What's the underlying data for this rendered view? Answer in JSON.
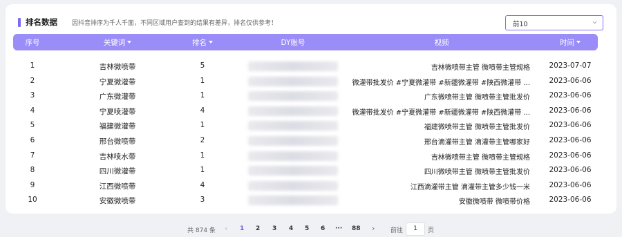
{
  "header": {
    "title": "排名数据",
    "subtitle": "因抖音排序为千人千面，不同区域用户查到的结果有差异，排名仅供参考！"
  },
  "filter": {
    "selected": "前10"
  },
  "table": {
    "columns": {
      "index": "序号",
      "keyword": "关键词",
      "rank": "排名",
      "account": "DY账号",
      "video": "视频",
      "time": "时间"
    },
    "rows": [
      {
        "index": "1",
        "keyword": "吉林微喷带",
        "rank": "5",
        "video": "吉林微喷带主管 微喷带主管规格",
        "time": "2023-07-07"
      },
      {
        "index": "2",
        "keyword": "宁夏微灌带",
        "rank": "1",
        "video": "微灌带批发价 #宁夏微灌带 #新疆微灌带 #陕西微灌带 ...",
        "time": "2023-06-06"
      },
      {
        "index": "3",
        "keyword": "广东微灌带",
        "rank": "1",
        "video": "广东微喷带主管 微喷带主管批发价",
        "time": "2023-06-06"
      },
      {
        "index": "4",
        "keyword": "宁夏喷灌带",
        "rank": "4",
        "video": "微灌带批发价 #宁夏微灌带 #新疆微灌带 #陕西微灌带 ...",
        "time": "2023-06-06"
      },
      {
        "index": "5",
        "keyword": "福建微灌带",
        "rank": "1",
        "video": "福建微喷带主管 微喷带主管批发价",
        "time": "2023-06-06"
      },
      {
        "index": "6",
        "keyword": "邢台微喷带",
        "rank": "2",
        "video": "邢台滴灌带主管 滴灌带主管哪家好",
        "time": "2023-06-06"
      },
      {
        "index": "7",
        "keyword": "吉林喷水带",
        "rank": "1",
        "video": "吉林微喷带主管 微喷带主管规格",
        "time": "2023-06-06"
      },
      {
        "index": "8",
        "keyword": "四川微灌带",
        "rank": "1",
        "video": "四川微喷带主管 微喷带主管批发价",
        "time": "2023-06-06"
      },
      {
        "index": "9",
        "keyword": "江西微喷带",
        "rank": "4",
        "video": "江西滴灌带主管 滴灌带主管多少钱一米",
        "time": "2023-06-06"
      },
      {
        "index": "10",
        "keyword": "安徽微喷带",
        "rank": "3",
        "video": "安徽微喷带 微喷带价格",
        "time": "2023-06-06"
      }
    ]
  },
  "pagination": {
    "total": "共 874 条",
    "prev": "‹",
    "pages": [
      "1",
      "2",
      "3",
      "4",
      "5",
      "6"
    ],
    "ellipsis": "···",
    "last": "88",
    "next": "›",
    "goto_prefix": "前往",
    "goto_value": "1",
    "goto_suffix": "页"
  },
  "colors": {
    "accent": "#7b6cf6",
    "header_bg": "#9a8df8"
  }
}
